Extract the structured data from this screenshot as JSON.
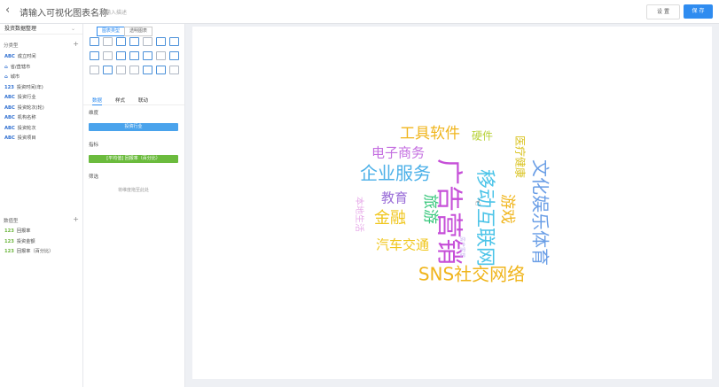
{
  "header": {
    "back_icon": "chevron-left-icon",
    "title": "请输入可视化图表名称",
    "hint": "请输入描述",
    "settings_label": "设 置",
    "publish_label": "保 存"
  },
  "left": {
    "datasource": "投资数据整理",
    "dimension_title": "分类型",
    "dimensions": [
      {
        "tag": "ABC",
        "name": "成立时间"
      },
      {
        "tag": "geo",
        "name": "省/直辖市"
      },
      {
        "tag": "geo",
        "name": "城市"
      },
      {
        "tag": "123",
        "name": "投资时间(年)"
      },
      {
        "tag": "ABC",
        "name": "投资行业"
      },
      {
        "tag": "ABC",
        "name": "投资轮次(轮)"
      },
      {
        "tag": "ABC",
        "name": "机构名称"
      },
      {
        "tag": "ABC",
        "name": "投资轮次"
      },
      {
        "tag": "ABC",
        "name": "投资项目"
      }
    ],
    "measure_title": "数值型",
    "measures": [
      {
        "tag": "123",
        "name": "回报率"
      },
      {
        "tag": "123",
        "name": "投资金额"
      },
      {
        "tag": "123",
        "name": "回报率（百分比）"
      }
    ]
  },
  "middle": {
    "toggle_a": "图表类型",
    "toggle_b": "透明图表",
    "tabs": [
      "数据",
      "样式",
      "联动"
    ],
    "dim_label": "维度",
    "dim_chip": "投资行业",
    "measure_label": "指标",
    "measure_chip": "[平均值] 回报率（百分比）",
    "filter_label": "筛选",
    "filter_drop": "将维度拖至此处"
  },
  "chart_data": {
    "type": "wordcloud",
    "words": [
      {
        "text": "广告营销",
        "color": "#c64fd8"
      },
      {
        "text": "移动互联网",
        "color": "#4cc4e8"
      },
      {
        "text": "SNS社交网络",
        "color": "#f0b51c"
      },
      {
        "text": "文化娱乐体育",
        "color": "#6a9ee6"
      },
      {
        "text": "企业服务",
        "color": "#4cb0e8"
      },
      {
        "text": "旅游",
        "color": "#38c77c"
      },
      {
        "text": "金融",
        "color": "#f0c61c"
      },
      {
        "text": "游戏",
        "color": "#f0b51c"
      },
      {
        "text": "工具软件",
        "color": "#f0b51c"
      },
      {
        "text": "汽车交通",
        "color": "#f0c61c"
      },
      {
        "text": "电子商务",
        "color": "#c46fe0"
      },
      {
        "text": "教育",
        "color": "#9b6fd8"
      },
      {
        "text": "医疗健康",
        "color": "#d9c21c"
      },
      {
        "text": "硬件",
        "color": "#b8d23a"
      },
      {
        "text": "本地生活",
        "color": "#e6a8e8"
      },
      {
        "text": "房产家居",
        "color": "#c7b0f0"
      }
    ]
  }
}
